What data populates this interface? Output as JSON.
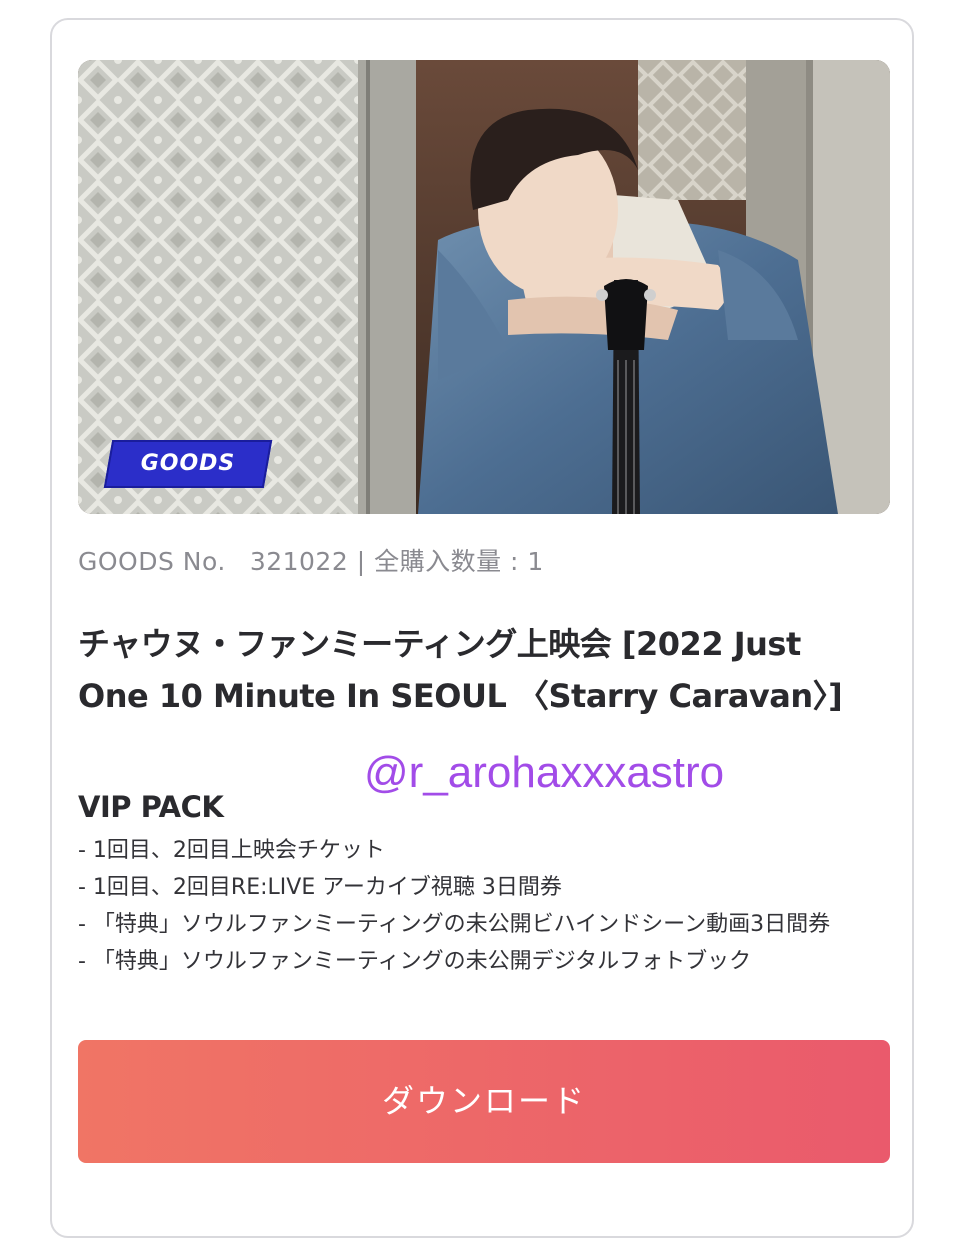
{
  "product": {
    "badge_label": "GOODS",
    "meta_label": "GOODS No.",
    "goods_number": "321022",
    "separator": "|",
    "purchase_count_text": "全購入数量 : 1",
    "title": "チャウヌ・ファンミーティング上映会 [2022 Just One 10 Minute In SEOUL 〈Starry Caravan〉]",
    "pack_name": "VIP PACK",
    "features": [
      "- 1回目、2回目上映会チケット",
      "- 1回目、2回目RE:LIVE アーカイブ視聴 3日間券",
      "- 「特典」ソウルファンミーティングの未公開ビハインドシーン動画3日間券",
      "- 「特典」ソウルファンミーティングの未公開デジタルフォトブック"
    ],
    "download_label": "ダウンロード"
  },
  "overlay": {
    "watermark_text": "@r_arohaxxxastro"
  },
  "colors": {
    "badge": "#2b2ec9",
    "button_start": "#f07565",
    "button_end": "#ea5a6c",
    "watermark": "#a24ce8",
    "meta_text": "#8a8a90"
  }
}
